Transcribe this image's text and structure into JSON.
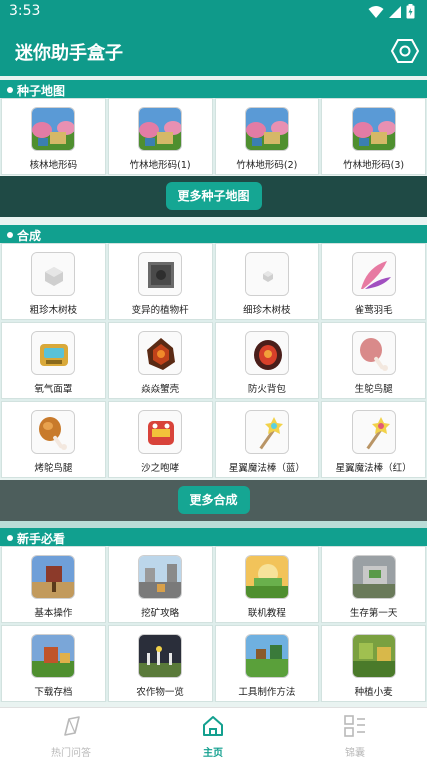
{
  "status": {
    "time": "3:53"
  },
  "app": {
    "title": "迷你助手盒子"
  },
  "sections": {
    "seed_maps": {
      "title": "种子地图",
      "items": [
        {
          "label": "核林地形码"
        },
        {
          "label": "竹林地形码(1)"
        },
        {
          "label": "竹林地形码(2)"
        },
        {
          "label": "竹林地形码(3)"
        }
      ],
      "more": "更多种子地图"
    },
    "crafting": {
      "title": "合成",
      "items": [
        {
          "label": "粗珍木树枝"
        },
        {
          "label": "变异的植物杆"
        },
        {
          "label": "细珍木树枝"
        },
        {
          "label": "雀莺羽毛"
        },
        {
          "label": "氧气面罩"
        },
        {
          "label": "焱焱蟹壳"
        },
        {
          "label": "防火背包"
        },
        {
          "label": "生鸵鸟腿"
        },
        {
          "label": "烤鸵鸟腿"
        },
        {
          "label": "沙之咆哮"
        },
        {
          "label": "星翼魔法棒（蓝）"
        },
        {
          "label": "星翼魔法棒（红）"
        }
      ],
      "more": "更多合成"
    },
    "newbie": {
      "title": "新手必看",
      "items": [
        {
          "label": "基本操作"
        },
        {
          "label": "挖矿攻略"
        },
        {
          "label": "联机教程"
        },
        {
          "label": "生存第一天"
        },
        {
          "label": "下载存档"
        },
        {
          "label": "农作物一览"
        },
        {
          "label": "工具制作方法"
        },
        {
          "label": "种植小麦"
        }
      ]
    }
  },
  "nav": {
    "items": [
      {
        "label": "热门问答",
        "icon": "compass-icon"
      },
      {
        "label": "主页",
        "icon": "home-icon"
      },
      {
        "label": "锦囊",
        "icon": "grid-list-icon"
      }
    ],
    "active_color": "#14a08f",
    "inactive_color": "#b9b9b9"
  },
  "colors": {
    "primary": "#0f9a8a",
    "section_header": "#11a08f",
    "band_dark": "#1f4a45",
    "band_mid": "#4d5e5c"
  }
}
